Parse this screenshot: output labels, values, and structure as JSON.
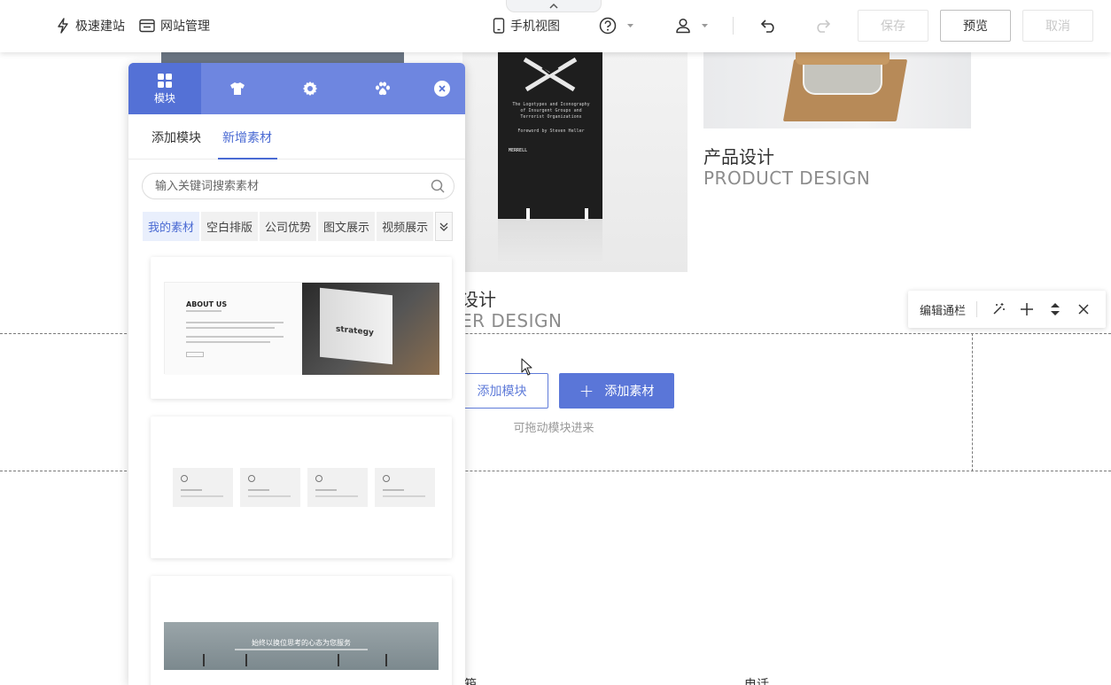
{
  "toolbar": {
    "fast_build": "极速建站",
    "site_manage": "网站管理",
    "mobile_view": "手机视图",
    "save": "保存",
    "preview": "预览",
    "cancel": "取消"
  },
  "canvas": {
    "caption_product_zh": "产品设计",
    "caption_product_en": "PRODUCT DESIGN",
    "caption_cover_zh": "设计",
    "caption_cover_en": "ER DESIGN",
    "book_lines": [
      "The Logotypes and Iconography",
      "of Insurgent Groups and",
      "Terrorist Organizations",
      "Foreword by Steven Heller",
      "MERRELL"
    ],
    "add_module": "添加模块",
    "add_material": "添加素材",
    "drag_hint": "可拖动模块进来",
    "footer_left": "箱",
    "footer_right": "电话"
  },
  "edit_bar": {
    "label": "编辑通栏"
  },
  "panel": {
    "tab_module": "模块",
    "subtab_add_module": "添加模块",
    "subtab_new_material": "新增素材",
    "search_placeholder": "输入关键词搜索素材",
    "categories": [
      "我的素材",
      "空白排版",
      "公司优势",
      "图文展示",
      "视频展示"
    ],
    "card1": {
      "heading": "ABOUT US",
      "photo_text": "strategy"
    },
    "card3": {
      "banner_text": "始终以换位思考的心态为您服务"
    }
  },
  "colors": {
    "accent": "#5a76d8",
    "panel_header": "#6e86e0",
    "panel_tab_active": "#5471d6"
  }
}
